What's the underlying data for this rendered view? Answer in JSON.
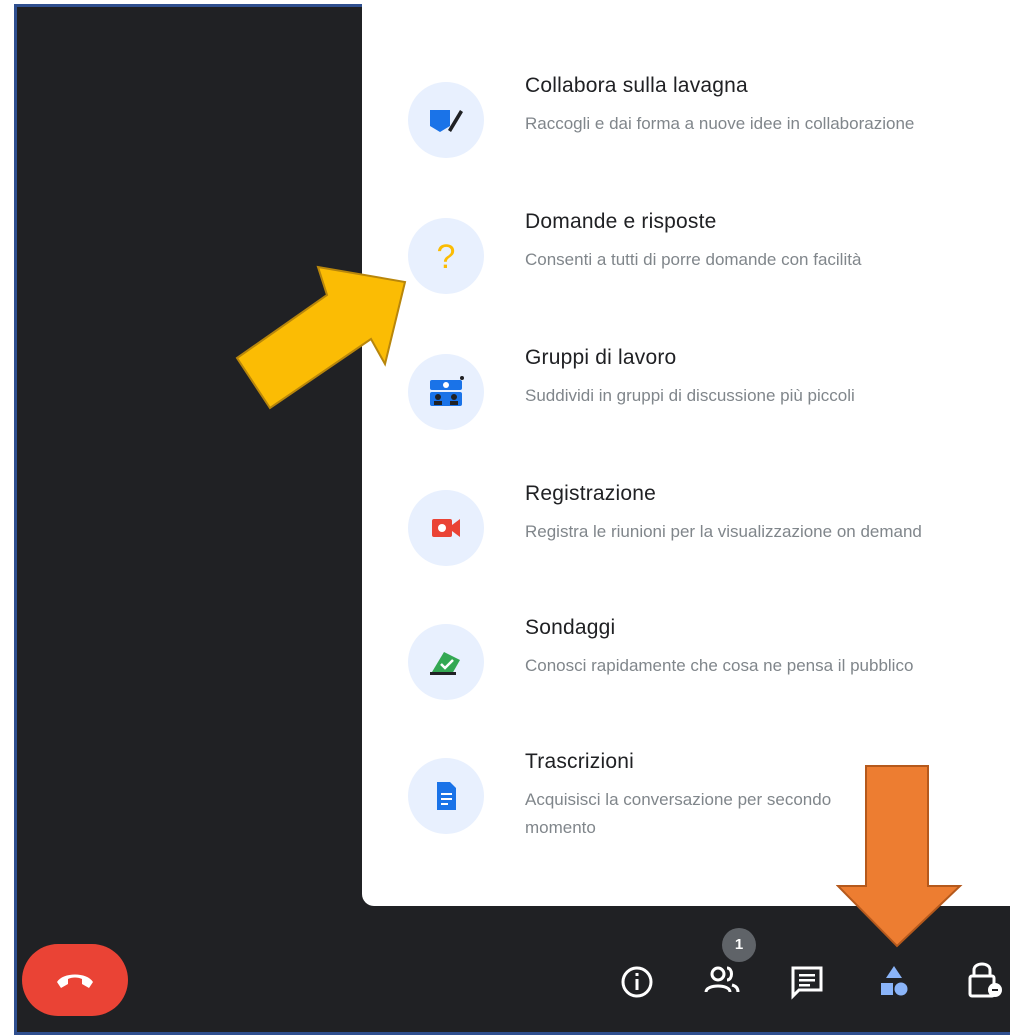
{
  "activities": [
    {
      "title": "Collabora sulla lavagna",
      "desc": "Raccogli e dai forma a nuove idee in collaborazione",
      "icon": "whiteboard-icon"
    },
    {
      "title": "Domande e risposte",
      "desc": "Consenti a tutti di porre domande con facilità",
      "icon": "question-mark-icon"
    },
    {
      "title": "Gruppi di lavoro",
      "desc": "Suddividi in gruppi di discussione più piccoli",
      "icon": "breakout-rooms-icon"
    },
    {
      "title": "Registrazione",
      "desc": "Registra le riunioni per la visualizzazione on demand",
      "icon": "recording-icon"
    },
    {
      "title": "Sondaggi",
      "desc": "Conosci rapidamente che cosa ne pensa il pubblico",
      "icon": "polls-icon"
    },
    {
      "title": "Trascrizioni",
      "desc": "Acquisisci la conversazione per secondo momento",
      "icon": "transcript-icon"
    }
  ],
  "toolbar": {
    "participants_count": "1",
    "buttons": [
      "info-icon",
      "people-icon",
      "chat-icon",
      "activities-icon",
      "host-controls-icon"
    ]
  },
  "colors": {
    "panel_bg": "#ffffff",
    "meeting_bg": "#202124",
    "end_call": "#ea4335",
    "accent_blue": "#1a73e8",
    "yellow_arrow": "#fbbc04",
    "orange_arrow": "#ed7d31"
  }
}
